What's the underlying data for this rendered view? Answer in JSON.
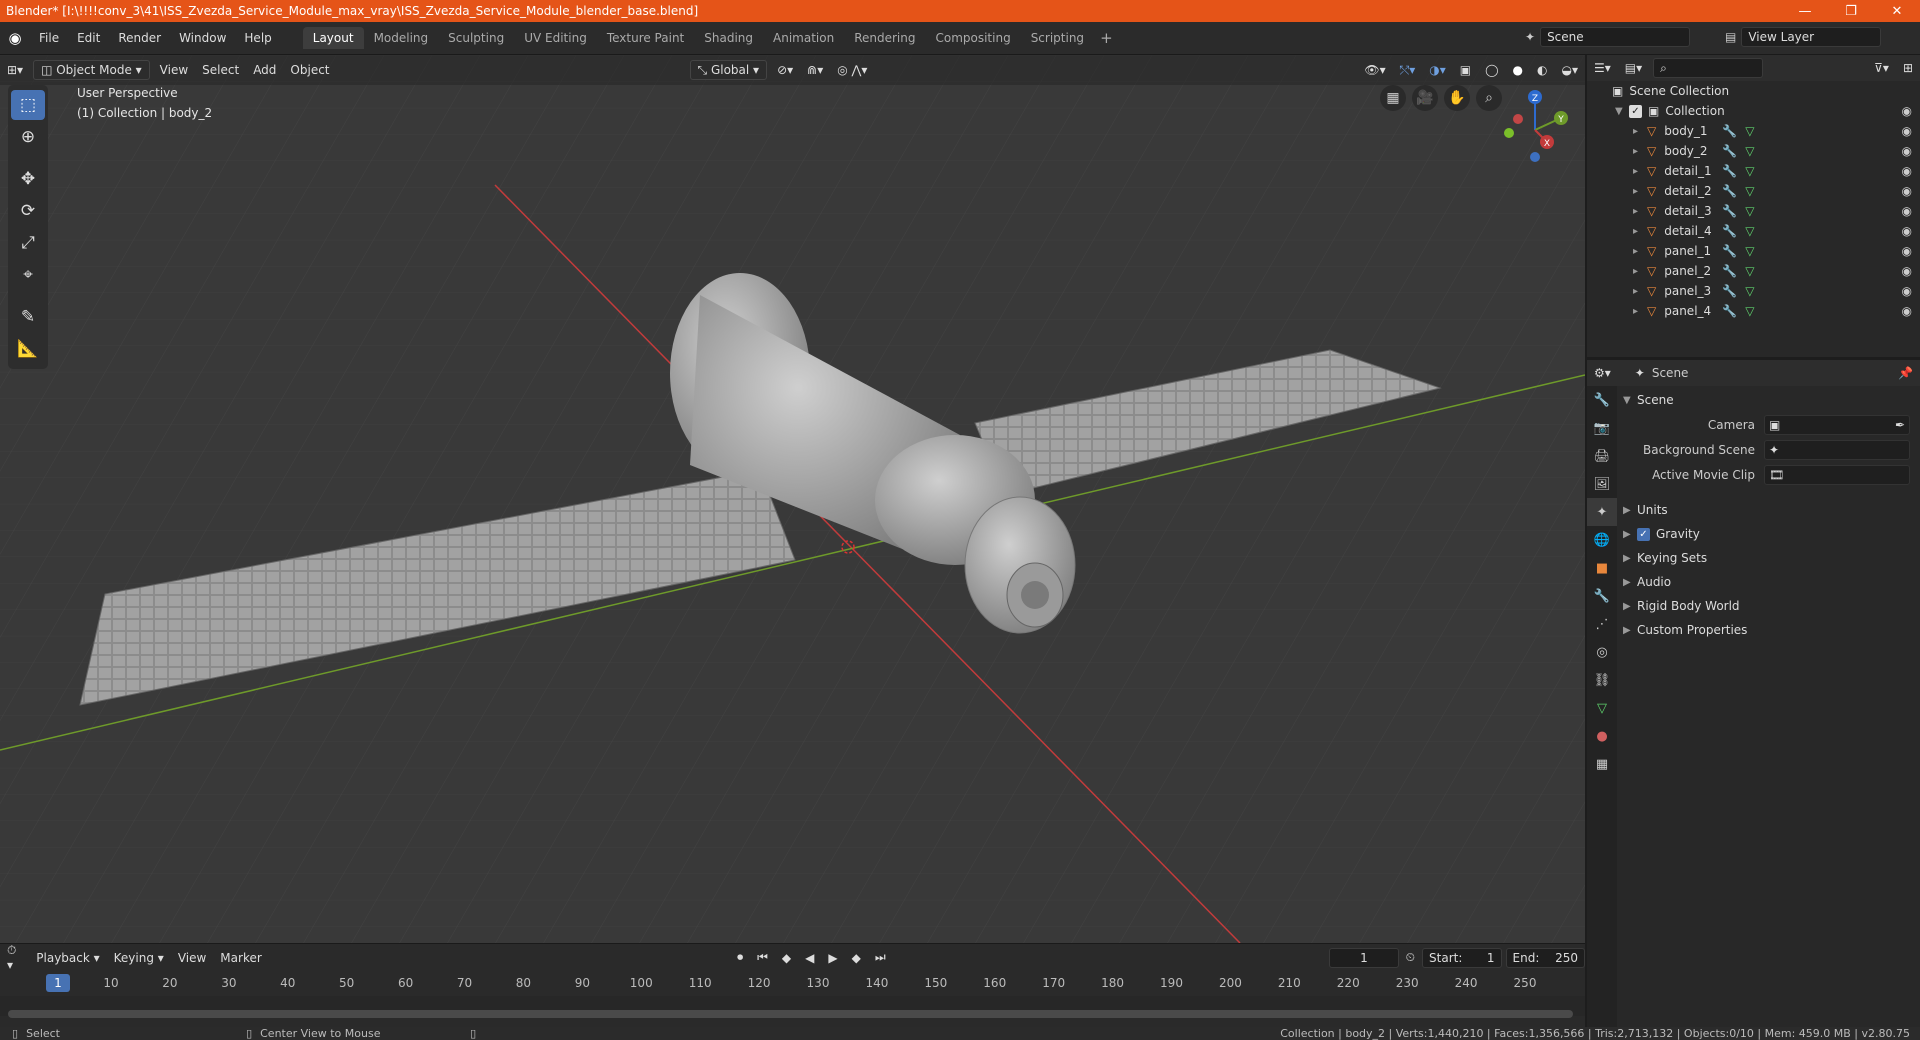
{
  "window": {
    "title": "Blender* [I:\\!!!!conv_3\\41\\ISS_Zvezda_Service_Module_max_vray\\ISS_Zvezda_Service_Module_blender_base.blend]",
    "minimize": "—",
    "restore": "❐",
    "close": "✕"
  },
  "menubar": {
    "items": [
      "File",
      "Edit",
      "Render",
      "Window",
      "Help"
    ]
  },
  "workspaces": [
    "Layout",
    "Modeling",
    "Sculpting",
    "UV Editing",
    "Texture Paint",
    "Shading",
    "Animation",
    "Rendering",
    "Compositing",
    "Scripting"
  ],
  "workspace_add": "+",
  "scene": {
    "label": "Scene",
    "view_layer": "View Layer"
  },
  "viewport": {
    "mode": "Object Mode",
    "menus": [
      "View",
      "Select",
      "Add",
      "Object"
    ],
    "transform_orientation": "Global",
    "info_line1": "User Perspective",
    "info_line2": "(1) Collection | body_2",
    "gizmo": {
      "x": "X",
      "y": "Y",
      "z": "Z"
    }
  },
  "timeline": {
    "menus": [
      "Playback",
      "Keying",
      "View",
      "Marker"
    ],
    "current_frame": "1",
    "start_label": "Start:",
    "start": "1",
    "end_label": "End:",
    "end": "250",
    "ticks": [
      "1",
      "10",
      "20",
      "30",
      "40",
      "50",
      "60",
      "70",
      "80",
      "90",
      "100",
      "110",
      "120",
      "130",
      "140",
      "150",
      "160",
      "170",
      "180",
      "190",
      "200",
      "210",
      "220",
      "230",
      "240",
      "250"
    ]
  },
  "statusbar": {
    "left": "Select",
    "mid": "Center View to Mouse",
    "right": "Collection | body_2 | Verts:1,440,210 | Faces:1,356,566 | Tris:2,713,132 | Objects:0/10 | Mem: 459.0 MB | v2.80.75"
  },
  "outliner": {
    "root": "Scene Collection",
    "collection": "Collection",
    "objects": [
      "body_1",
      "body_2",
      "detail_1",
      "detail_2",
      "detail_3",
      "detail_4",
      "panel_1",
      "panel_2",
      "panel_3",
      "panel_4"
    ]
  },
  "properties": {
    "header": "Scene",
    "section": "Scene",
    "fields": [
      {
        "label": "Camera"
      },
      {
        "label": "Background Scene"
      },
      {
        "label": "Active Movie Clip"
      }
    ],
    "panels": [
      "Units",
      "Gravity",
      "Keying Sets",
      "Audio",
      "Rigid Body World",
      "Custom Properties"
    ]
  },
  "colors": {
    "title_bar": "#e55418",
    "accent": "#4772b3",
    "x_axis": "#c23b3b",
    "y_axis": "#6e9a2a",
    "object_icon": "#e8873c",
    "mesh_icon": "#5fd16c"
  }
}
